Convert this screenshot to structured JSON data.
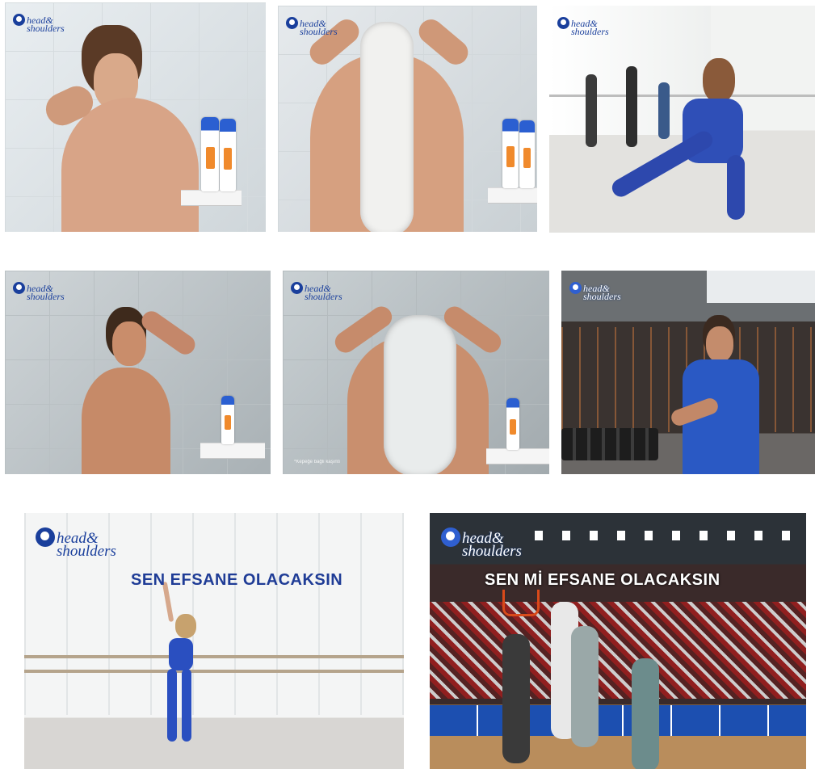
{
  "brand": {
    "logo_line1": "head&",
    "logo_line2": "shoulders"
  },
  "panels": [
    {
      "scene": "woman-shower-rinse"
    },
    {
      "scene": "woman-shower-lather-back"
    },
    {
      "scene": "dancer-stretch-studio"
    },
    {
      "scene": "man-shower-rinse"
    },
    {
      "scene": "man-shower-lather-back",
      "note": "*Kepeğe bağlı kaşıntı"
    },
    {
      "scene": "basketball-player-gym"
    },
    {
      "scene": "ballerina-barre",
      "caption": "SEN EFSANE OLACAKSIN"
    },
    {
      "scene": "basketball-arena",
      "caption": "SEN Mİ EFSANE OLACAKSIN"
    }
  ],
  "colors": {
    "brand_blue": "#1a3f9c",
    "caption_blue": "#1f3c96",
    "caption_white": "#ffffff"
  }
}
